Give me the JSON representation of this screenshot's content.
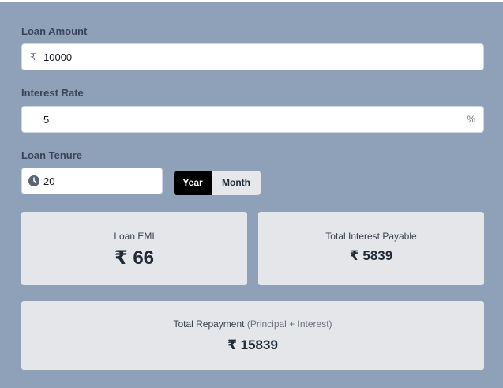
{
  "loan_amount": {
    "label": "Loan Amount",
    "currency_symbol": "₹",
    "value": "10000"
  },
  "interest_rate": {
    "label": "Interest Rate",
    "value": "5",
    "unit": "%"
  },
  "loan_tenure": {
    "label": "Loan Tenure",
    "icon": "clock-icon",
    "value": "20",
    "options": [
      "Year",
      "Month"
    ],
    "selected": "Year"
  },
  "results": {
    "emi": {
      "title": "Loan EMI",
      "value": "₹ 66"
    },
    "total_interest": {
      "title": "Total Interest Payable",
      "value": "₹ 5839"
    },
    "total_repayment": {
      "title": "Total Repayment",
      "title_note": "(Principal + Interest)",
      "value": "₹ 15839"
    }
  },
  "colors": {
    "background": "#8fa0b9",
    "card": "#e4e6ea",
    "toggle_active": "#000000",
    "toggle_inactive": "#e5e7eb"
  }
}
